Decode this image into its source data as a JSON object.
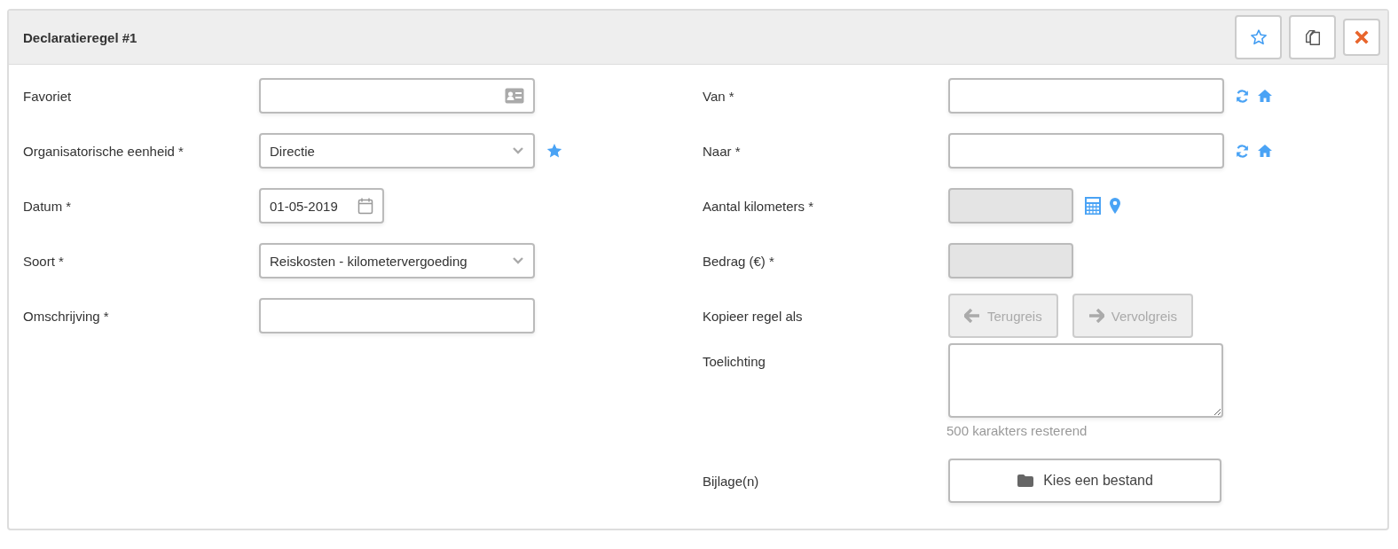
{
  "panel": {
    "title": "Declaratieregel #1"
  },
  "left_fields": [
    {
      "kind": "lookup",
      "label": "Favoriet"
    },
    {
      "kind": "select-favorite",
      "label": "Organisatorische eenheid *",
      "value": "Directie"
    },
    {
      "kind": "date",
      "label": "Datum *",
      "value": "01-05-2019"
    },
    {
      "kind": "select",
      "label": "Soort *",
      "value": "Reiskosten - kilometervergoeding"
    },
    {
      "kind": "text",
      "label": "Omschrijving *"
    }
  ],
  "right_fields": [
    {
      "kind": "address",
      "label": "Van *"
    },
    {
      "kind": "address",
      "label": "Naar *"
    },
    {
      "kind": "distance",
      "label": "Aantal kilometers *",
      "disabled": true
    },
    {
      "kind": "amount",
      "label": "Bedrag (€) *",
      "disabled": true
    },
    {
      "kind": "copy-buttons",
      "label": "Kopieer regel als",
      "buttons": [
        {
          "label": "Terugreis",
          "kind": "back",
          "disabled": true
        },
        {
          "label": "Vervolgreis",
          "kind": "forward",
          "disabled": true
        }
      ]
    },
    {
      "kind": "textarea",
      "label": "Toelichting",
      "counter": "500 karakters resterend"
    },
    {
      "kind": "file",
      "label": "Bijlage(n)",
      "button": "Kies een bestand"
    }
  ]
}
